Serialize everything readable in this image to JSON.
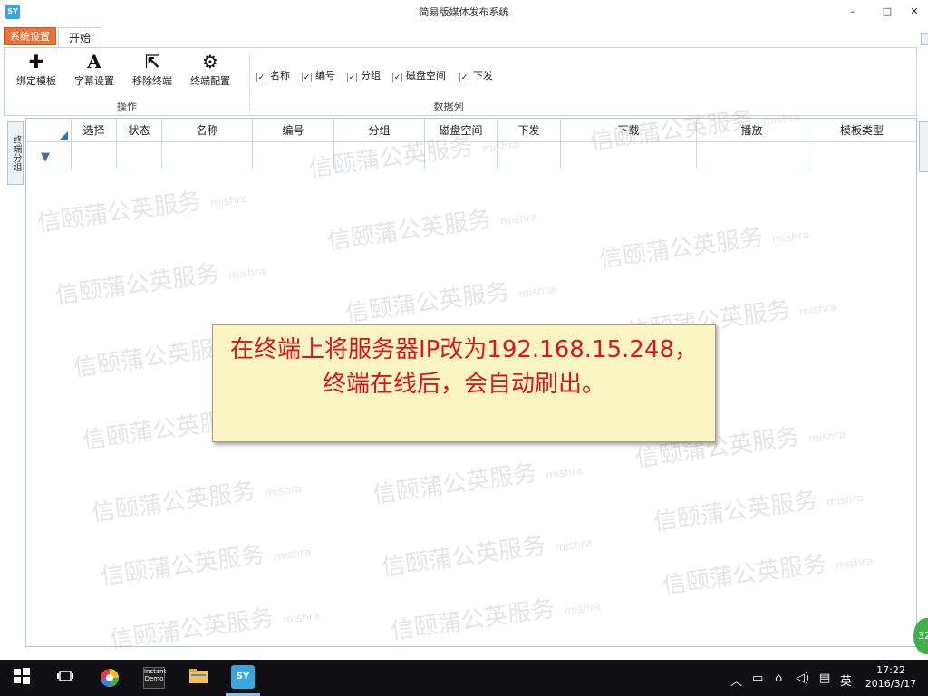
{
  "window": {
    "title": "简易版媒体发布系统",
    "app_icon": "SY",
    "minimize": "–",
    "maximize": "□",
    "close": "✕"
  },
  "tabs": {
    "system": "系统设置",
    "start": "开始"
  },
  "ribbon": {
    "operations": [
      {
        "icon": "plus-icon",
        "glyph": "✚",
        "label": "绑定模板"
      },
      {
        "icon": "font-a-icon",
        "glyph": "A",
        "label": "字幕设置"
      },
      {
        "icon": "share-export-icon",
        "glyph": "⇱",
        "label": "移除终端"
      },
      {
        "icon": "gear-icon",
        "glyph": "⚙",
        "label": "终端配置"
      }
    ],
    "operations_group": "操作",
    "columns_group": "数据列",
    "column_checks": [
      {
        "label": "名称",
        "checked": true
      },
      {
        "label": "编号",
        "checked": true
      },
      {
        "label": "分组",
        "checked": true
      },
      {
        "label": "磁盘空间",
        "checked": true
      },
      {
        "label": "下发",
        "checked": true
      }
    ]
  },
  "side_panel": {
    "left_label": "终端分组"
  },
  "grid": {
    "columns": [
      "选择",
      "状态",
      "名称",
      "编号",
      "分组",
      "磁盘空间",
      "下发",
      "下载",
      "播放",
      "模板类型"
    ],
    "rows": []
  },
  "toast": {
    "message": "在终端上将服务器IP改为192.168.15.248，终端在线后，会自动刷出。"
  },
  "badge": {
    "value": "32"
  },
  "watermark": {
    "text": "信颐蒲公英服务",
    "sub": "mishra"
  },
  "taskbar": {
    "ime": "英",
    "time": "17:22",
    "date": "2016/3/17",
    "demo_label": "Instant Demo"
  },
  "colors": {
    "system_tab": "#e8743a",
    "toast_bg": "#fbf5c4",
    "toast_text": "#e0141c",
    "taskbar": "#101014"
  }
}
